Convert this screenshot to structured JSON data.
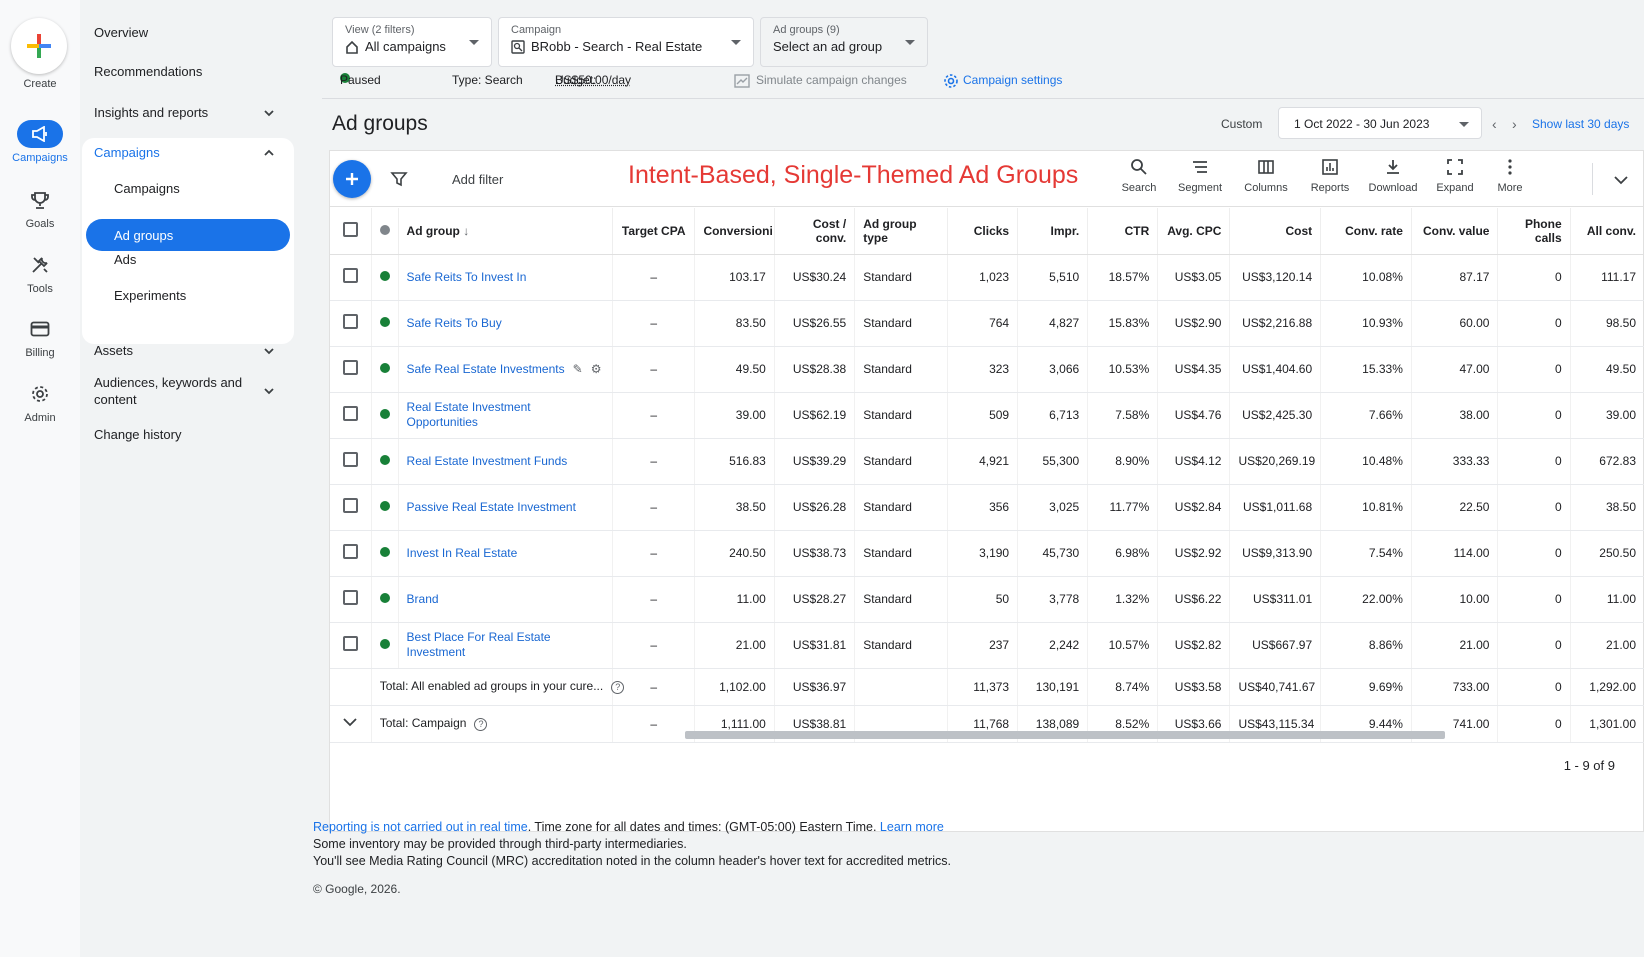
{
  "rail": {
    "create": "Create",
    "items": [
      {
        "label": "Campaigns",
        "icon": "campaigns-icon"
      },
      {
        "label": "Goals",
        "icon": "trophy-icon"
      },
      {
        "label": "Tools",
        "icon": "tools-icon"
      },
      {
        "label": "Billing",
        "icon": "billing-icon"
      },
      {
        "label": "Admin",
        "icon": "gear-icon"
      }
    ]
  },
  "nav": {
    "overview": "Overview",
    "recommendations": "Recommendations",
    "insights": "Insights and reports",
    "campaigns_section": "Campaigns",
    "sub": [
      "Campaigns",
      "Ad groups",
      "Ads",
      "Experiments"
    ],
    "assets": "Assets",
    "audiences": "Audiences, keywords and content",
    "change_history": "Change history"
  },
  "header": {
    "view_small": "View (2 filters)",
    "view_main": "All campaigns",
    "campaign_small": "Campaign",
    "campaign_main": "BRobb - Search - Real Estate",
    "adgroups_small": "Ad groups (9)",
    "adgroups_main": "Select an ad group",
    "status": "Paused",
    "type": "Type: Search",
    "budget_label": "Budget:",
    "budget_value": "US$50.00/day",
    "simulate": "Simulate campaign changes",
    "settings": "Campaign settings"
  },
  "page": {
    "title": "Ad groups",
    "custom": "Custom",
    "date_range": "1 Oct 2022 - 30 Jun 2023",
    "show_last": "Show last 30 days",
    "add_filter": "Add filter",
    "overlay_title": "Intent-Based, Single-Themed Ad Groups"
  },
  "toolbar": [
    "Search",
    "Segment",
    "Columns",
    "Reports",
    "Download",
    "Expand",
    "More"
  ],
  "table": {
    "headers": [
      "Ad group",
      "Target CPA",
      "Conversioni",
      "Cost / conv.",
      "Ad group type",
      "Clicks",
      "Impr.",
      "CTR",
      "Avg. CPC",
      "Cost",
      "Conv. rate",
      "Conv. value",
      "Phone calls",
      "All conv."
    ],
    "rows": [
      [
        "Safe Reits To Invest In",
        "–",
        "103.17",
        "US$30.24",
        "Standard",
        "1,023",
        "5,510",
        "18.57%",
        "US$3.05",
        "US$3,120.14",
        "10.08%",
        "87.17",
        "0",
        "111.17"
      ],
      [
        "Safe Reits To Buy",
        "–",
        "83.50",
        "US$26.55",
        "Standard",
        "764",
        "4,827",
        "15.83%",
        "US$2.90",
        "US$2,216.88",
        "10.93%",
        "60.00",
        "0",
        "98.50"
      ],
      [
        "Safe Real Estate Investments",
        "–",
        "49.50",
        "US$28.38",
        "Standard",
        "323",
        "3,066",
        "10.53%",
        "US$4.35",
        "US$1,404.60",
        "15.33%",
        "47.00",
        "0",
        "49.50"
      ],
      [
        "Real Estate Investment Opportunities",
        "–",
        "39.00",
        "US$62.19",
        "Standard",
        "509",
        "6,713",
        "7.58%",
        "US$4.76",
        "US$2,425.30",
        "7.66%",
        "38.00",
        "0",
        "39.00"
      ],
      [
        "Real Estate Investment Funds",
        "–",
        "516.83",
        "US$39.29",
        "Standard",
        "4,921",
        "55,300",
        "8.90%",
        "US$4.12",
        "US$20,269.19",
        "10.48%",
        "333.33",
        "0",
        "672.83"
      ],
      [
        "Passive Real Estate Investment",
        "–",
        "38.50",
        "US$26.28",
        "Standard",
        "356",
        "3,025",
        "11.77%",
        "US$2.84",
        "US$1,011.68",
        "10.81%",
        "22.50",
        "0",
        "38.50"
      ],
      [
        "Invest In Real Estate",
        "–",
        "240.50",
        "US$38.73",
        "Standard",
        "3,190",
        "45,730",
        "6.98%",
        "US$2.92",
        "US$9,313.90",
        "7.54%",
        "114.00",
        "0",
        "250.50"
      ],
      [
        "Brand",
        "–",
        "11.00",
        "US$28.27",
        "Standard",
        "50",
        "3,778",
        "1.32%",
        "US$6.22",
        "US$311.01",
        "22.00%",
        "10.00",
        "0",
        "11.00"
      ],
      [
        "Best Place For Real Estate Investment",
        "–",
        "21.00",
        "US$31.81",
        "Standard",
        "237",
        "2,242",
        "10.57%",
        "US$2.82",
        "US$667.97",
        "8.86%",
        "21.00",
        "0",
        "21.00"
      ]
    ],
    "total_enabled": [
      "Total: All enabled ad groups in your cure...",
      "–",
      "1,102.00",
      "US$36.97",
      "",
      "11,373",
      "130,191",
      "8.74%",
      "US$3.58",
      "US$40,741.67",
      "9.69%",
      "733.00",
      "0",
      "1,292.00"
    ],
    "total_campaign": [
      "Total: Campaign",
      "–",
      "1,111.00",
      "US$38.81",
      "",
      "11,768",
      "138,089",
      "8.52%",
      "US$3.66",
      "US$43,115.34",
      "9.44%",
      "741.00",
      "0",
      "1,301.00"
    ],
    "pager": "1 - 9 of 9"
  },
  "footer": {
    "reporting_link": "Reporting is not carried out in real time",
    "timezone": ". Time zone for all dates and times: (GMT-05:00) Eastern Time.",
    "learn_more": "Learn more",
    "line2": "Some inventory may be provided through third-party intermediaries.",
    "line3": "You'll see Media Rating Council (MRC) accreditation noted in the column header's hover text for accredited metrics.",
    "copyright": "© Google, 2026."
  },
  "colors": {
    "accent": "#1a73e8",
    "enabled": "#188038",
    "overlay": "#e53935"
  }
}
